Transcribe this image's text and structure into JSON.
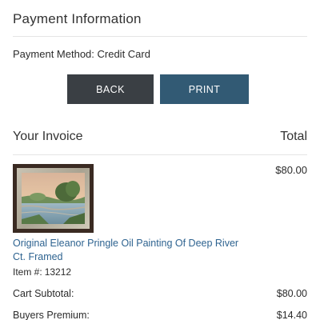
{
  "payment": {
    "heading": "Payment Information",
    "method_label": "Payment Method: Credit Card"
  },
  "actions": {
    "back_label": "BACK",
    "print_label": "PRINT",
    "button_colors": {
      "back": "#3a3f44",
      "print": "#325a74"
    }
  },
  "invoice": {
    "heading": "Your Invoice",
    "total_heading": "Total",
    "item": {
      "title": "Original Eleanor Pringle Oil Painting Of Deep River Ct. Framed",
      "price": "$80.00",
      "item_number_label": "Item #:",
      "item_number": "13212",
      "link_color": "#2e6390"
    },
    "summary": [
      {
        "label": "Cart Subtotal:",
        "value": "$80.00"
      },
      {
        "label": "Buyers Premium:",
        "value": "$14.40"
      }
    ]
  }
}
